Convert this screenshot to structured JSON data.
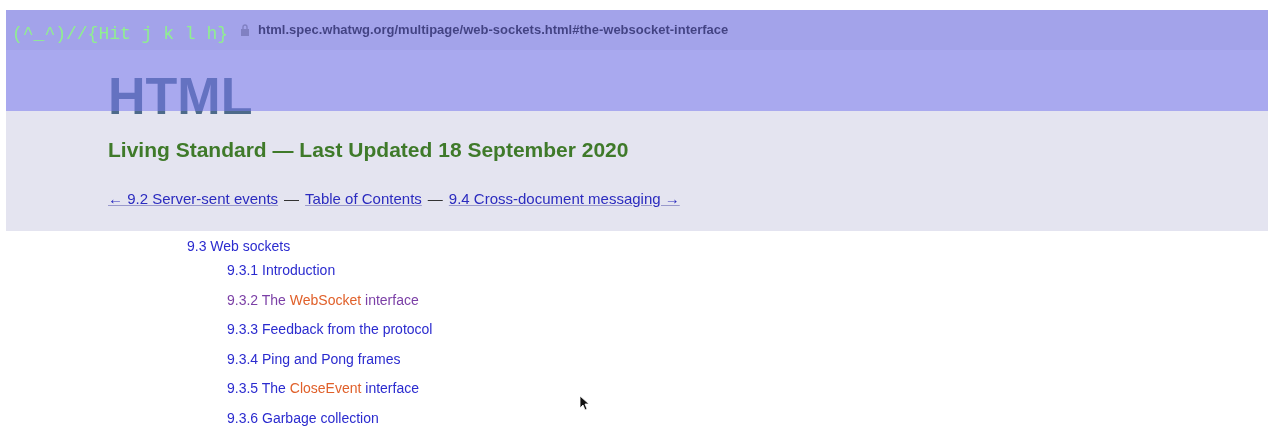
{
  "overlay": {
    "text": "(^_^)//{Hit j k l h}"
  },
  "address_bar": {
    "url": "html.spec.whatwg.org/multipage/web-sockets.html#the-websocket-interface"
  },
  "header": {
    "logo": "HTML",
    "subtitle": "Living Standard — Last Updated 18 September 2020",
    "nav": [
      {
        "kind": "link",
        "text": "← 9.2 Server-sent events"
      },
      {
        "kind": "separator",
        "text": "—"
      },
      {
        "kind": "link",
        "text": "Table of Contents"
      },
      {
        "kind": "separator",
        "text": "—"
      },
      {
        "kind": "link",
        "text": "9.4 Cross-document messaging →"
      }
    ]
  },
  "toc": {
    "title": "9.3 Web sockets",
    "children": [
      {
        "visited": false,
        "parts": [
          {
            "kind": "text",
            "text": "9.3.1 Introduction"
          }
        ]
      },
      {
        "visited": true,
        "parts": [
          {
            "kind": "text",
            "text": "9.3.2 The "
          },
          {
            "kind": "code",
            "text": "WebSocket"
          },
          {
            "kind": "text",
            "text": " interface"
          }
        ]
      },
      {
        "visited": false,
        "parts": [
          {
            "kind": "text",
            "text": "9.3.3 Feedback from the protocol"
          }
        ]
      },
      {
        "visited": false,
        "parts": [
          {
            "kind": "text",
            "text": "9.3.4 Ping and Pong frames"
          }
        ]
      },
      {
        "visited": false,
        "parts": [
          {
            "kind": "text",
            "text": "9.3.5 The "
          },
          {
            "kind": "code",
            "text": "CloseEvent"
          },
          {
            "kind": "text",
            "text": " interface"
          }
        ]
      },
      {
        "visited": false,
        "parts": [
          {
            "kind": "text",
            "text": "9.3.6 Garbage collection"
          }
        ]
      }
    ]
  }
}
